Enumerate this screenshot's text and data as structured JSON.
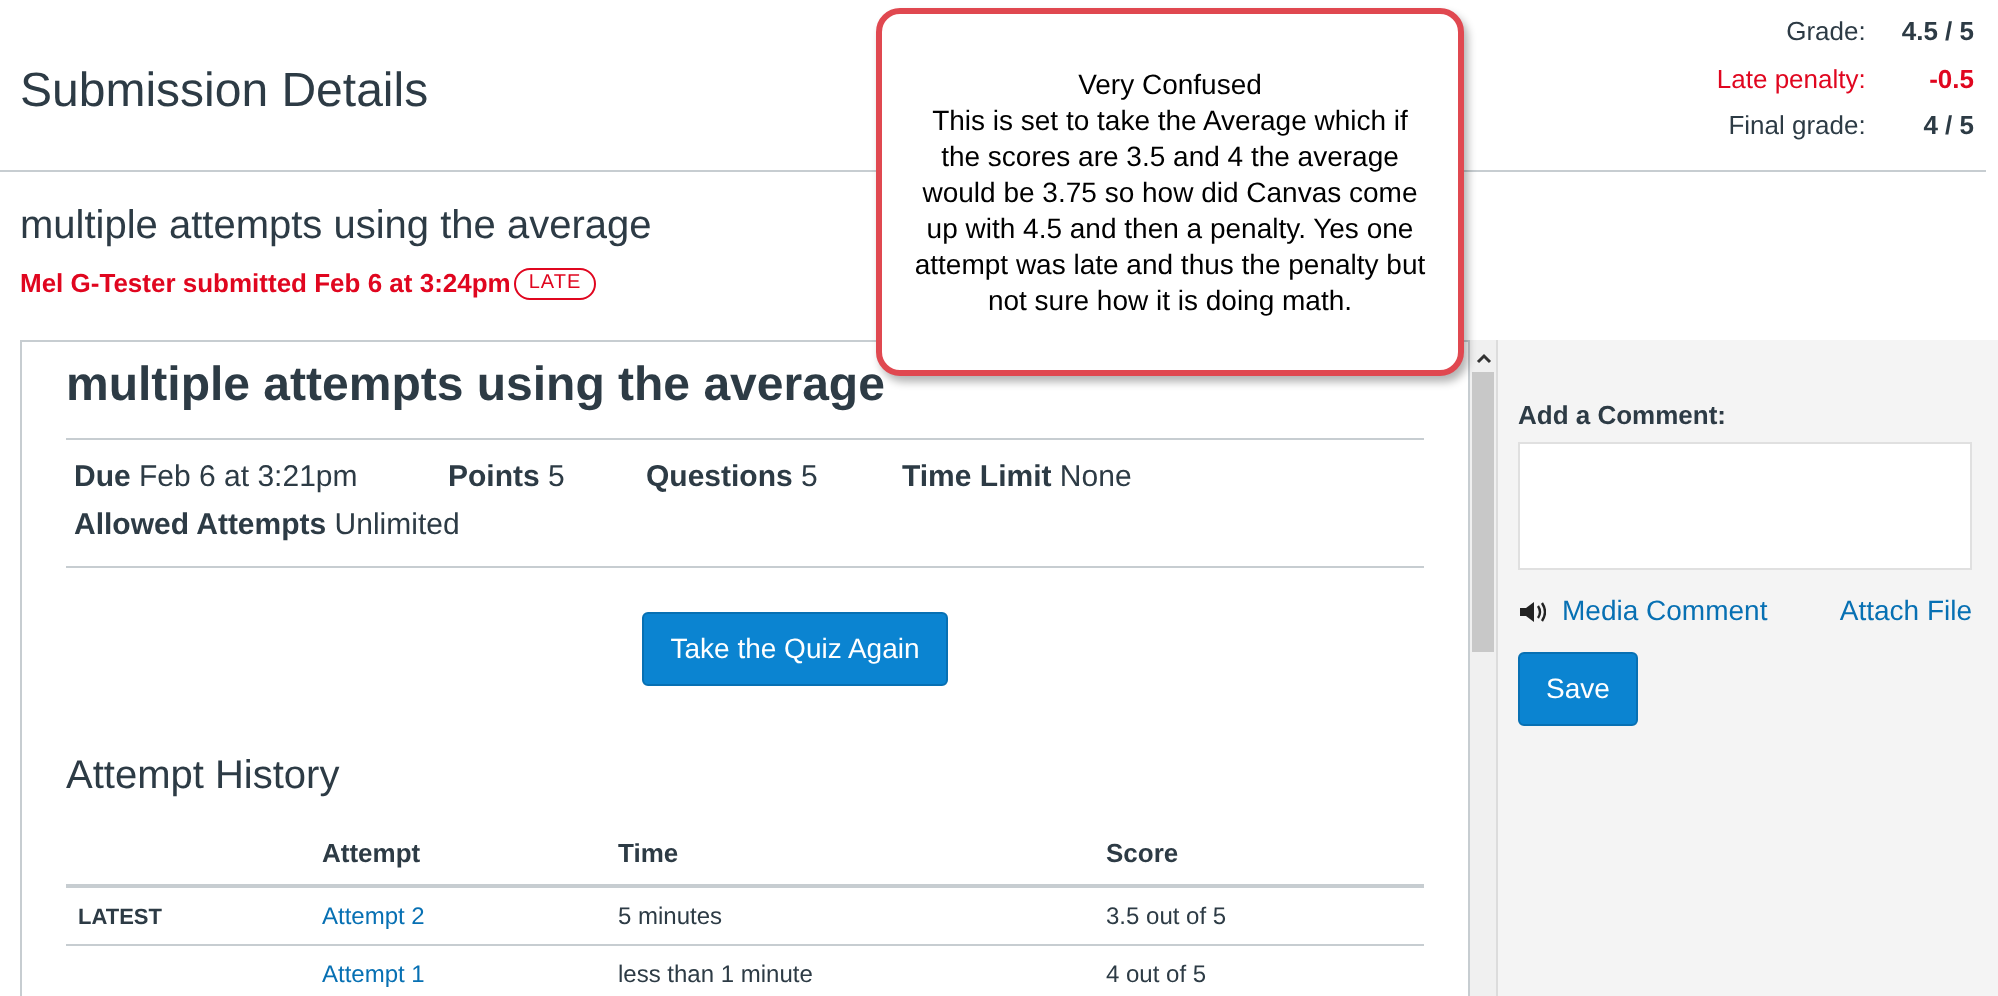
{
  "page_title": "Submission Details",
  "grades": [
    {
      "label": "Grade:",
      "value": "4.5 / 5",
      "kind": "normal"
    },
    {
      "label": "Late penalty:",
      "value": "-0.5",
      "kind": "penalty"
    },
    {
      "label": "Final grade:",
      "value": "4 / 5",
      "kind": "normal"
    }
  ],
  "assignment_title": "multiple attempts using the average",
  "submitted_line": "Mel G-Tester submitted Feb 6 at 3:24pm",
  "late_badge": "LATE",
  "quiz": {
    "title": "multiple attempts using the average",
    "details": [
      {
        "label": "Due",
        "value": "Feb 6 at 3:21pm"
      },
      {
        "label": "Points",
        "value": "5"
      },
      {
        "label": "Questions",
        "value": "5"
      },
      {
        "label": "Time Limit",
        "value": "None"
      },
      {
        "label": "Allowed Attempts",
        "value": "Unlimited"
      }
    ],
    "button": "Take the Quiz Again",
    "history_title": "Attempt History",
    "columns": [
      "Attempt",
      "Time",
      "Score"
    ],
    "rows": [
      {
        "tag": "LATEST",
        "attempt": "Attempt 2",
        "time": "5 minutes",
        "score": "3.5 out of 5"
      },
      {
        "attempt": "Attempt 1",
        "time": "less than 1 minute",
        "score": "4 out of 5"
      }
    ]
  },
  "comment": {
    "label": "Add a Comment:",
    "media": "Media Comment",
    "attach": "Attach File",
    "save": "Save"
  },
  "callout": {
    "title": "Very Confused",
    "text": "This is set to take the Average which if the scores are 3.5 and 4 the average would be 3.75 so how did Canvas come up with 4.5 and then a penalty. Yes one attempt was late and thus the penalty but not sure how it is doing math."
  }
}
